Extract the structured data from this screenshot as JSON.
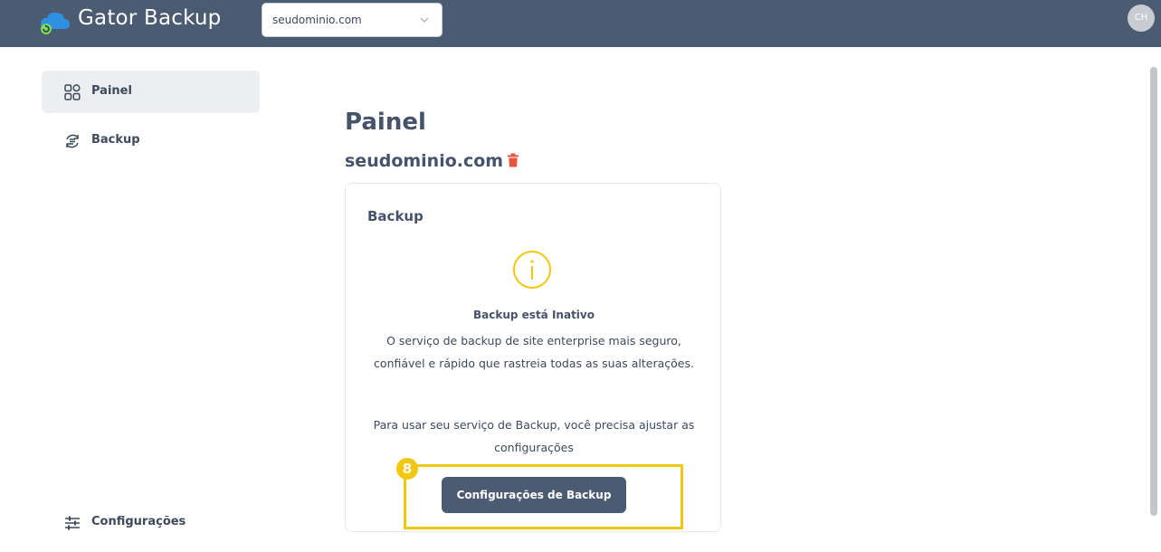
{
  "header": {
    "brand": "Gator Backup",
    "domain_select_value": "seudominio.com",
    "avatar_initials": "CH"
  },
  "sidebar": {
    "items": [
      {
        "label": "Painel",
        "icon": "dashboard-grid-icon",
        "active": true
      },
      {
        "label": "Backup",
        "icon": "backup-sync-icon",
        "active": false
      }
    ],
    "bottom_item": {
      "label": "Configurações",
      "icon": "sliders-icon"
    }
  },
  "main": {
    "title": "Painel",
    "domain": "seudominio.com",
    "card": {
      "title": "Backup",
      "status_title": "Backup está Inativo",
      "description": "O serviço de backup de site enterprise mais seguro, confiável e rápido que rastreia todas as suas alterações.",
      "instructions": "Para usar seu serviço de Backup, você precisa ajustar as configurações",
      "button_label": "Configurações de Backup"
    }
  },
  "annotation": {
    "step_number": "8"
  },
  "colors": {
    "topbar": "#4b5b72",
    "accent_yellow": "#f2c80f",
    "danger": "#e8553f",
    "logo_blue": "#2f8fe0",
    "logo_green": "#7bdc58"
  }
}
